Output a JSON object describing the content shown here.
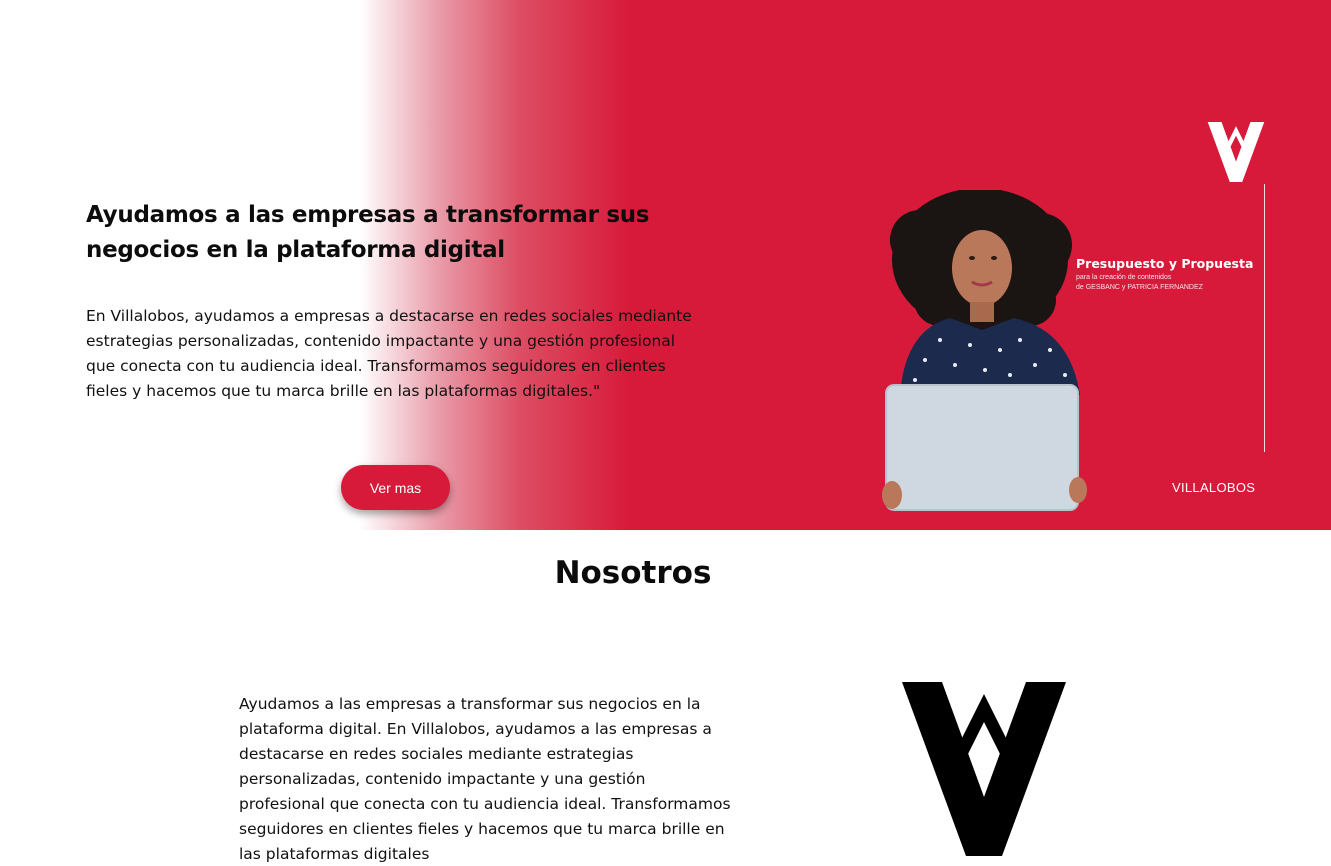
{
  "hero": {
    "title": "Ayudamos a las empresas a transformar sus negocios en la plataforma digital",
    "description": "En Villalobos, ayudamos a empresas a destacarse en redes sociales mediante estrategias personalizadas, contenido impactante y una gestión profesional que conecta con tu audiencia ideal. Transformamos seguidores en clientes fieles y hacemos que tu marca brille en las plataformas digitales.\"",
    "button_label": "Ver mas",
    "accent_color": "#d71a3a"
  },
  "promo": {
    "title": "Presupuesto y Propuesta",
    "subtitle_line1": "para la creación de contenidos",
    "subtitle_line2": "de GESBANC y PATRICIA FERNANDEZ",
    "brand": "VILLALOBOS",
    "icons": [
      "villalobos-logo-icon"
    ]
  },
  "about": {
    "title": "Nosotros",
    "text": "Ayudamos a las empresas a transformar sus negocios en la plataforma digital. En Villalobos, ayudamos a las empresas a destacarse en redes sociales mediante estrategias personalizadas, contenido impactante y una gestión profesional que conecta con tu audiencia ideal. Transformamos seguidores en clientes fieles y hacemos que tu marca brille en las plataformas digitales"
  }
}
